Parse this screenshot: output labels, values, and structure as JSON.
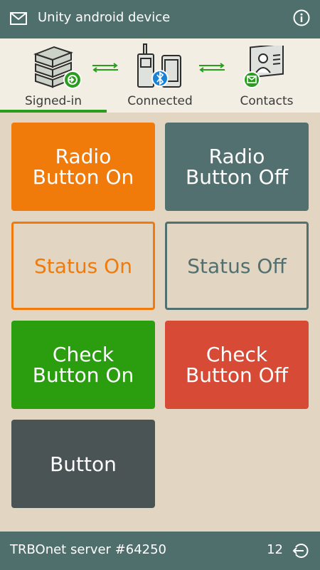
{
  "header": {
    "title": "Unity android device"
  },
  "status": {
    "items": [
      {
        "label": "Signed-in"
      },
      {
        "label": "Connected"
      },
      {
        "label": "Contacts"
      }
    ]
  },
  "buttons": {
    "radio_on": "Radio\nButton On",
    "radio_off": "Radio\nButton Off",
    "status_on": "Status On",
    "status_off": "Status Off",
    "check_on": "Check\nButton On",
    "check_off": "Check\nButton Off",
    "button": "Button"
  },
  "footer": {
    "server": "TRBOnet server #64250",
    "count": "12"
  },
  "colors": {
    "bar": "#4f6f6d",
    "background": "#e2d5c1",
    "orange": "#f07a0a",
    "slate": "#52706f",
    "green": "#2b9e10",
    "red": "#d74a35",
    "dark": "#4b5454",
    "active_underline": "#2a9d1f"
  }
}
